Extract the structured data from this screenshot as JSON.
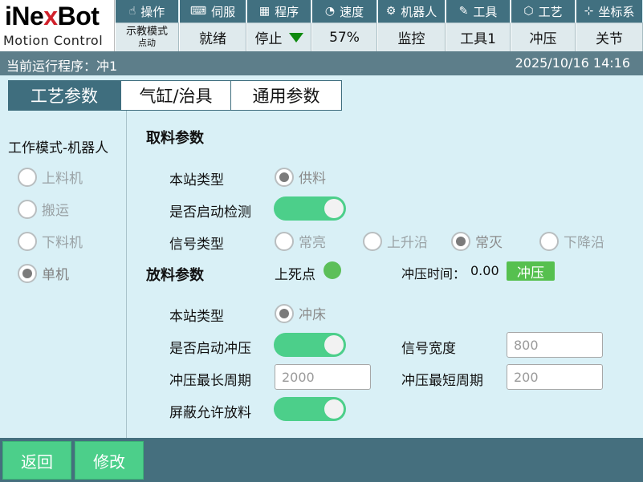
{
  "logo": {
    "brand_pre": "iNe",
    "brand_x": "x",
    "brand_post": "Bot",
    "subtitle": "Motion Control"
  },
  "top_tabs": [
    {
      "icon": "☝",
      "label": "操作",
      "value": "示教模式",
      "value_small": "点动"
    },
    {
      "icon": "⌨",
      "label": "伺服",
      "value": "就绪"
    },
    {
      "icon": "▦",
      "label": "程序",
      "value": "停止"
    },
    {
      "icon": "◔",
      "label": "速度",
      "value": "57%"
    },
    {
      "icon": "⚙",
      "label": "机器人",
      "value": "监控"
    },
    {
      "icon": "✎",
      "label": "工具",
      "value": "工具1"
    },
    {
      "icon": "⬡",
      "label": "工艺",
      "value": "冲压"
    },
    {
      "icon": "⊹",
      "label": "坐标系",
      "value": "关节"
    }
  ],
  "status": {
    "program": "当前运行程序：冲1",
    "datetime": "2025/10/16 14:16"
  },
  "main_tabs": [
    "工艺参数",
    "气缸/治具",
    "通用参数"
  ],
  "left": {
    "title": "工作模式-机器人",
    "options": [
      "上料机",
      "搬运",
      "下料机",
      "单机"
    ],
    "selected_index": 3
  },
  "pick": {
    "title": "取料参数",
    "station_type_label": "本站类型",
    "station_type_value": "供料",
    "enable_detect_label": "是否启动检测",
    "enable_detect": true,
    "signal_type_label": "信号类型",
    "signal_options": [
      "常亮",
      "上升沿",
      "常灭",
      "下降沿"
    ],
    "signal_selected_index": 2
  },
  "place": {
    "title": "放料参数",
    "tdc_label": "上死点",
    "press_time_label": "冲压时间：",
    "press_time_value": "0.00",
    "press_button": "冲压",
    "station_type_label": "本站类型",
    "station_type_value": "冲床",
    "enable_press_label": "是否启动冲压",
    "enable_press": true,
    "signal_width_label": "信号宽度",
    "signal_width_value": "800",
    "max_cycle_label": "冲压最长周期",
    "max_cycle_value": "2000",
    "min_cycle_label": "冲压最短周期",
    "min_cycle_value": "200",
    "mask_allow_label": "屏蔽允许放料",
    "mask_allow": true
  },
  "bottom": {
    "back": "返回",
    "modify": "修改"
  },
  "colors": {
    "accent": "#3f6e7e",
    "toggle_on": "#4ccf8a",
    "indicator": "#5cbf59",
    "background": "#d9f0f6"
  }
}
